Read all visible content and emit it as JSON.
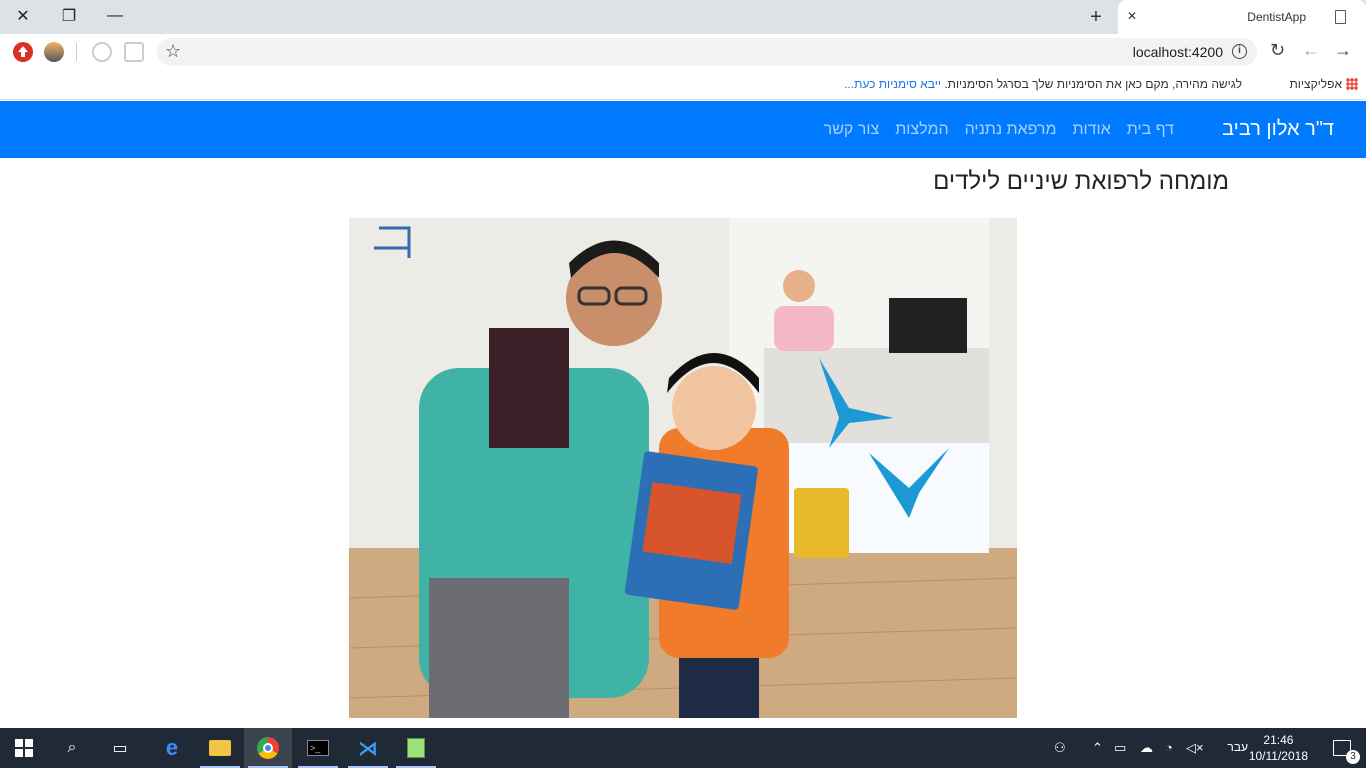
{
  "browser": {
    "tab_title": "DentistApp",
    "url": "localhost:4200",
    "new_tab_symbol": "+",
    "bookmarks": {
      "apps_label": "אפליקציות",
      "hint_text": "לגישה מהירה, מקם כאן את הסימניות שלך בסרגל הסימניות.",
      "import_link": "ייבא סימניות כעת..."
    }
  },
  "navbar": {
    "brand": "ד\"ר אלון רביב",
    "links": [
      "דף בית",
      "אודות",
      "מרפאת נתניה",
      "המלצות",
      "צור קשר"
    ]
  },
  "main": {
    "heading": "מומחה לרפואת שיניים לילדים"
  },
  "taskbar": {
    "language": "עבר",
    "time": "21:46",
    "date": "10/11/2018",
    "notification_count": "3"
  },
  "colors": {
    "navbar": "#007bff",
    "taskbar": "#1f2a36",
    "tabstrip": "#dee1e6"
  }
}
